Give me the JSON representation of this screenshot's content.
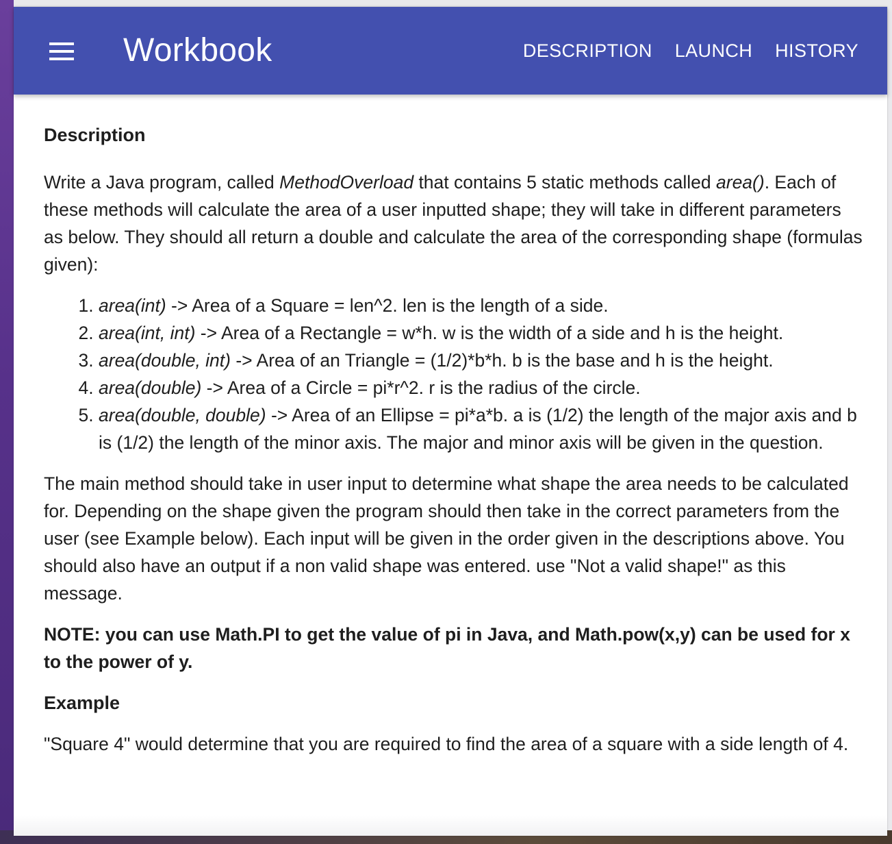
{
  "app_bar": {
    "title": "Workbook",
    "menu_icon": "hamburger-menu-icon",
    "nav": [
      "DESCRIPTION",
      "LAUNCH",
      "HISTORY"
    ],
    "background": "#4350af"
  },
  "content": {
    "heading": "Description",
    "intro": {
      "t1": "Write a Java program, called ",
      "class_name": "MethodOverload",
      "t2": " that contains 5 static methods called ",
      "method_name": "area()",
      "t3": ". Each of these methods will calculate the area of a user inputted shape; they will take in different parameters as below. They should all return a double and calculate the area of the corresponding shape (formulas given):"
    },
    "methods": [
      {
        "signature": "area(int)",
        "text": " -> Area of a Square = len^2. len is the length of a side."
      },
      {
        "signature": "area(int, int)",
        "text": " -> Area of a Rectangle = w*h. w is the width of a side and h is the height."
      },
      {
        "signature": "area(double, int)",
        "text": " -> Area of an Triangle = (1/2)*b*h. b is the base and h is the height."
      },
      {
        "signature": "area(double)",
        "text": " -> Area of a Circle = pi*r^2. r is the radius of the circle."
      },
      {
        "signature": "area(double, double)",
        "text": " -> Area of an Ellipse = pi*a*b. a is (1/2) the length of the major axis and b is (1/2) the length of the minor axis. The major and minor axis will be given in the question."
      }
    ],
    "main_paragraph": "The main method should take in user input to determine what shape the area needs to be calculated for. Depending on the shape given the program should then take in the correct parameters from the user (see Example below). Each input will be given in the order given in the descriptions above. You should also have an output if a non valid shape was entered. use \"Not a valid shape!\" as this message.",
    "note": "NOTE: you can use Math.PI to get the value of pi in Java, and Math.pow(x,y) can be used for x to the power of y.",
    "example_heading": "Example",
    "example_text": "\"Square 4\" would determine that you are required to find the area of a square with a side length of 4."
  }
}
